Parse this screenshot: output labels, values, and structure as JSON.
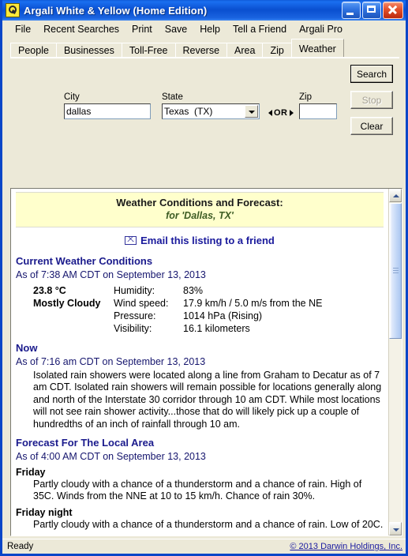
{
  "window": {
    "title": "Argali White & Yellow (Home Edition)",
    "icon": "argali-logo-icon",
    "minimize_label": "",
    "maximize_label": "",
    "close_label": ""
  },
  "menu": {
    "items": [
      {
        "label": "File"
      },
      {
        "label": "Recent Searches"
      },
      {
        "label": "Print"
      },
      {
        "label": "Save"
      },
      {
        "label": "Help"
      },
      {
        "label": "Tell a Friend"
      },
      {
        "label": "Argali Pro"
      }
    ]
  },
  "tabs": [
    {
      "label": "People",
      "active": false
    },
    {
      "label": "Businesses",
      "active": false
    },
    {
      "label": "Toll-Free",
      "active": false
    },
    {
      "label": "Reverse",
      "active": false
    },
    {
      "label": "Area",
      "active": false
    },
    {
      "label": "Zip",
      "active": false
    },
    {
      "label": "Weather",
      "active": true
    }
  ],
  "search_form": {
    "city": {
      "label": "City",
      "value": "dallas",
      "placeholder": ""
    },
    "state": {
      "label": "State",
      "value": "Texas  (TX)",
      "options": [
        "Texas  (TX)"
      ]
    },
    "separator": "OR",
    "zip": {
      "label": "Zip",
      "value": "",
      "placeholder": ""
    },
    "buttons": {
      "search": "Search",
      "stop": "Stop",
      "clear": "Clear"
    }
  },
  "results": {
    "header": {
      "title": "Weather Conditions and Forecast:",
      "subtitle": "for 'Dallas, TX'"
    },
    "email_link": "Email this listing to a friend",
    "current": {
      "title": "Current Weather Conditions",
      "as_of": "As of 7:38 AM CDT on September 13, 2013",
      "temperature": "23.8 °C",
      "sky": "Mostly Cloudy",
      "rows": [
        {
          "key": "Humidity:",
          "value": "83%"
        },
        {
          "key": "Wind speed:",
          "value": "17.9 km/h / 5.0 m/s from the NE"
        },
        {
          "key": "Pressure:",
          "value": "1014 hPa (Rising)"
        },
        {
          "key": "Visibility:",
          "value": "16.1 kilometers"
        }
      ]
    },
    "now": {
      "title": "Now",
      "as_of": "As of 7:16 am CDT on September 13, 2013",
      "text": "Isolated rain showers were located along a line from Graham to Decatur as of 7 am CDT. Isolated rain showers will remain possible for locations generally along and north of the Interstate 30 corridor through 10 am CDT. While most locations will not see rain shower activity...those that do will likely pick up a couple of hundredths of an inch of rainfall through 10 am."
    },
    "forecast": {
      "title": "Forecast For The Local Area",
      "as_of": "As of 4:00 AM CDT on September 13, 2013",
      "periods": [
        {
          "day": "Friday",
          "text": "Partly cloudy with a chance of a thunderstorm and a chance of rain. High of 35C. Winds from the NNE at 10 to 15 km/h. Chance of rain 30%."
        },
        {
          "day": "Friday night",
          "text": "Partly cloudy with a chance of a thunderstorm and a chance of rain. Low of 20C."
        }
      ]
    }
  },
  "scrollbar": {
    "up_arrow": "scroll-up-arrow",
    "down_arrow": "scroll-down-arrow"
  },
  "statusbar": {
    "status": "Ready",
    "copyright": "© 2013 Darwin Holdings, Inc."
  }
}
